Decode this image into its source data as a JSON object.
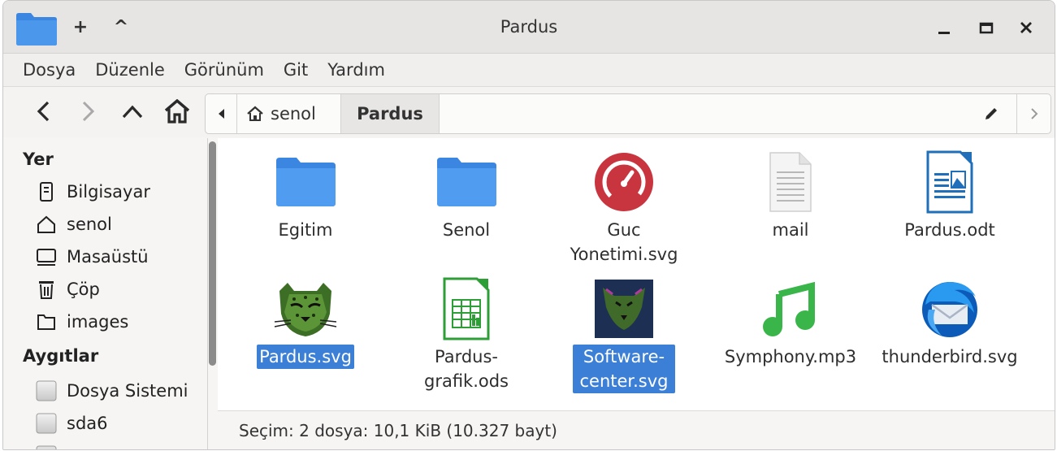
{
  "window": {
    "title": "Pardus",
    "new_tab_symbol": "+",
    "collapse_symbol": "^"
  },
  "menubar": [
    "Dosya",
    "Düzenle",
    "Görünüm",
    "Git",
    "Yardım"
  ],
  "toolbar": {
    "icons": [
      "back-icon",
      "forward-icon",
      "up-icon",
      "home-icon"
    ]
  },
  "pathbar": {
    "home_crumb": "senol",
    "current_crumb": "Pardus"
  },
  "sidebar": {
    "places_heading": "Yer",
    "places": [
      {
        "label": "Bilgisayar",
        "icon": "computer-icon"
      },
      {
        "label": "senol",
        "icon": "home-icon"
      },
      {
        "label": "Masaüstü",
        "icon": "desktop-icon"
      },
      {
        "label": "Çöp",
        "icon": "trash-icon"
      },
      {
        "label": "images",
        "icon": "folder-icon"
      }
    ],
    "devices_heading": "Aygıtlar",
    "devices": [
      {
        "label": "Dosya Sistemi",
        "icon": "drive-icon"
      },
      {
        "label": "sda6",
        "icon": "drive-icon"
      }
    ]
  },
  "files": [
    {
      "name": "Egitim",
      "type": "folder",
      "selected": false
    },
    {
      "name": "Senol",
      "type": "folder",
      "selected": false
    },
    {
      "name": "Guc Yonetimi.svg",
      "type": "power-svg",
      "selected": false
    },
    {
      "name": "mail",
      "type": "text",
      "selected": false
    },
    {
      "name": "Pardus.odt",
      "type": "odt",
      "selected": false
    },
    {
      "name": "Pardus.svg",
      "type": "pardus-svg",
      "selected": true
    },
    {
      "name": "Pardus-grafik.ods",
      "type": "ods",
      "selected": false
    },
    {
      "name": "Software-center.svg",
      "type": "software-svg",
      "selected": true
    },
    {
      "name": "Symphony.mp3",
      "type": "mp3",
      "selected": false
    },
    {
      "name": "thunderbird.svg",
      "type": "thunderbird-svg",
      "selected": false
    }
  ],
  "status": "Seçim: 2 dosya: 10,1 KiB (10.327 bayt)",
  "colors": {
    "selection": "#3c7fd6",
    "folder": "#4a8fe0",
    "window_bg": "#f6f5f4"
  }
}
